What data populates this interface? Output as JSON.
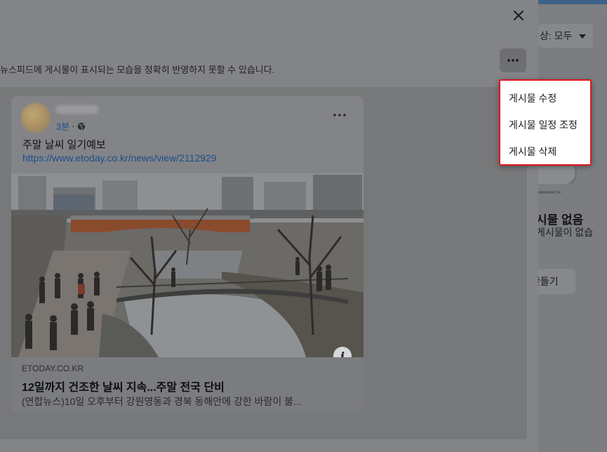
{
  "modal": {
    "notice": "뉴스피드에 게시물이 표시되는 모습을 정확히 반영하지 못할 수 있습니다.",
    "close_icon": "close-icon",
    "more_icon": "more-horizontal-icon"
  },
  "post": {
    "time": "3분",
    "separator": "·",
    "audience_icon": "globe-icon",
    "text": "주말 날씨 일기예보",
    "link_url": "https://www.etoday.co.kr/news/view/2112929",
    "link_card": {
      "domain": "ETODAY.CO.KR",
      "title": "12일까지 건조한 날씨 지속...주말 전국 단비",
      "description": "(연합뉴스)10일 오후부터 강원영동과 경북 동해안에 강한 바람이 불..."
    },
    "info_label": "i"
  },
  "menu": {
    "items": [
      {
        "label": "게시물 수정"
      },
      {
        "label": "게시물 일정 조정"
      },
      {
        "label": "게시물 삭제"
      }
    ],
    "highlight_color": "#e0161e"
  },
  "background": {
    "filter_label": "상: 모두",
    "empty_title": "시물 없음",
    "empty_subtitle": "게시물이 없습",
    "create_button": "만들기"
  }
}
